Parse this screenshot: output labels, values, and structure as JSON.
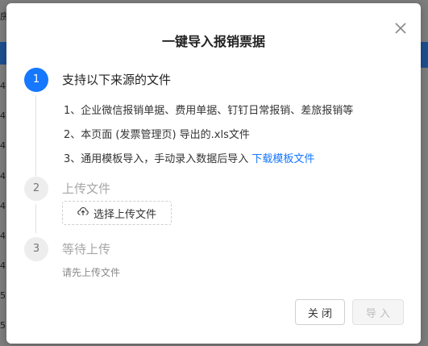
{
  "background": {
    "left_chars": [
      "房",
      "4",
      "4",
      "4",
      "4",
      "4",
      "4",
      "4",
      "5",
      "5",
      "4",
      "4"
    ]
  },
  "modal": {
    "title": "一键导入报销票据",
    "close_icon": "close-icon"
  },
  "steps": [
    {
      "number": "1",
      "title": "支持以下来源的文件",
      "state": "active",
      "lines": [
        "1、企业微信报销单据、费用单据、钉钉日常报销、差旅报销等",
        "2、本页面 (发票管理页) 导出的.xls文件",
        "3、通用模板导入，手动录入数据后导入 "
      ],
      "download_link": "下载模板文件"
    },
    {
      "number": "2",
      "title": "上传文件",
      "state": "inactive",
      "upload_button": "选择上传文件",
      "upload_icon": "upload-cloud-icon"
    },
    {
      "number": "3",
      "title": "等待上传",
      "state": "inactive",
      "hint": "请先上传文件"
    }
  ],
  "footer": {
    "close_label": "关 闭",
    "import_label": "导 入"
  },
  "colors": {
    "accent": "#1677ff",
    "overlay": "#7d7d7d"
  }
}
